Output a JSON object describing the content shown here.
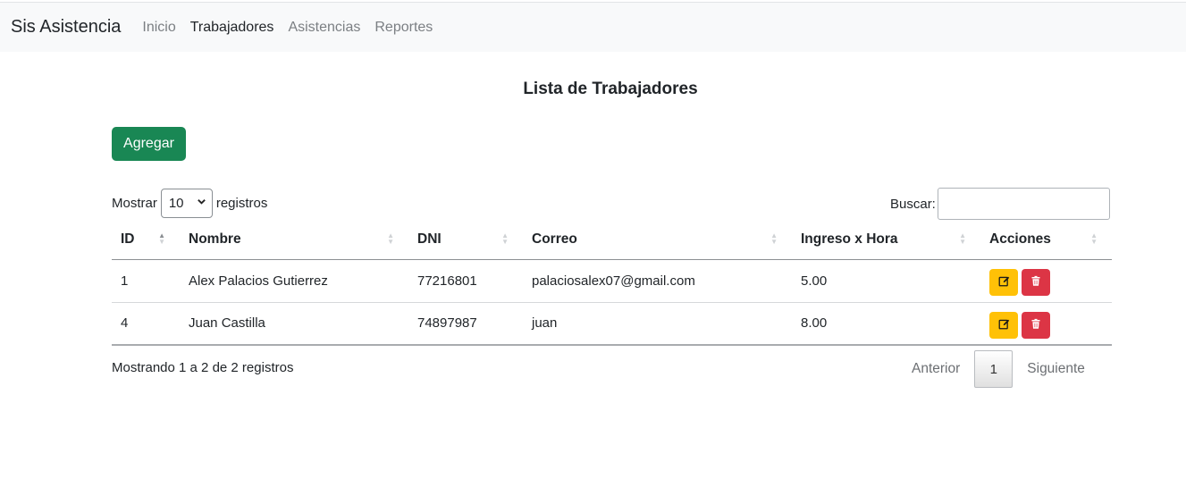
{
  "navbar": {
    "brand": "Sis Asistencia",
    "links": [
      {
        "label": "Inicio",
        "active": false
      },
      {
        "label": "Trabajadores",
        "active": true
      },
      {
        "label": "Asistencias",
        "active": false
      },
      {
        "label": "Reportes",
        "active": false
      }
    ]
  },
  "page": {
    "title": "Lista de Trabajadores",
    "add_label": "Agregar"
  },
  "length": {
    "prefix": "Mostrar",
    "value": "10",
    "suffix": "registros"
  },
  "search": {
    "label": "Buscar:",
    "value": ""
  },
  "table": {
    "headers": [
      "ID",
      "Nombre",
      "DNI",
      "Correo",
      "Ingreso x Hora",
      "Acciones"
    ],
    "rows": [
      {
        "id": "1",
        "nombre": "Alex Palacios Gutierrez",
        "dni": "77216801",
        "correo": "palaciosalex07@gmail.com",
        "ingreso": "5.00"
      },
      {
        "id": "4",
        "nombre": "Juan Castilla",
        "dni": "74897987",
        "correo": "juan",
        "ingreso": "8.00"
      }
    ]
  },
  "footer": {
    "info": "Mostrando 1 a 2 de 2 registros",
    "prev": "Anterior",
    "current": "1",
    "next": "Siguiente"
  },
  "colors": {
    "add": "#198754",
    "edit": "#ffc107",
    "delete": "#dc3545"
  },
  "icons": {
    "edit": "pencil-square-icon",
    "delete": "trash-icon",
    "sort": "sort-icon"
  }
}
